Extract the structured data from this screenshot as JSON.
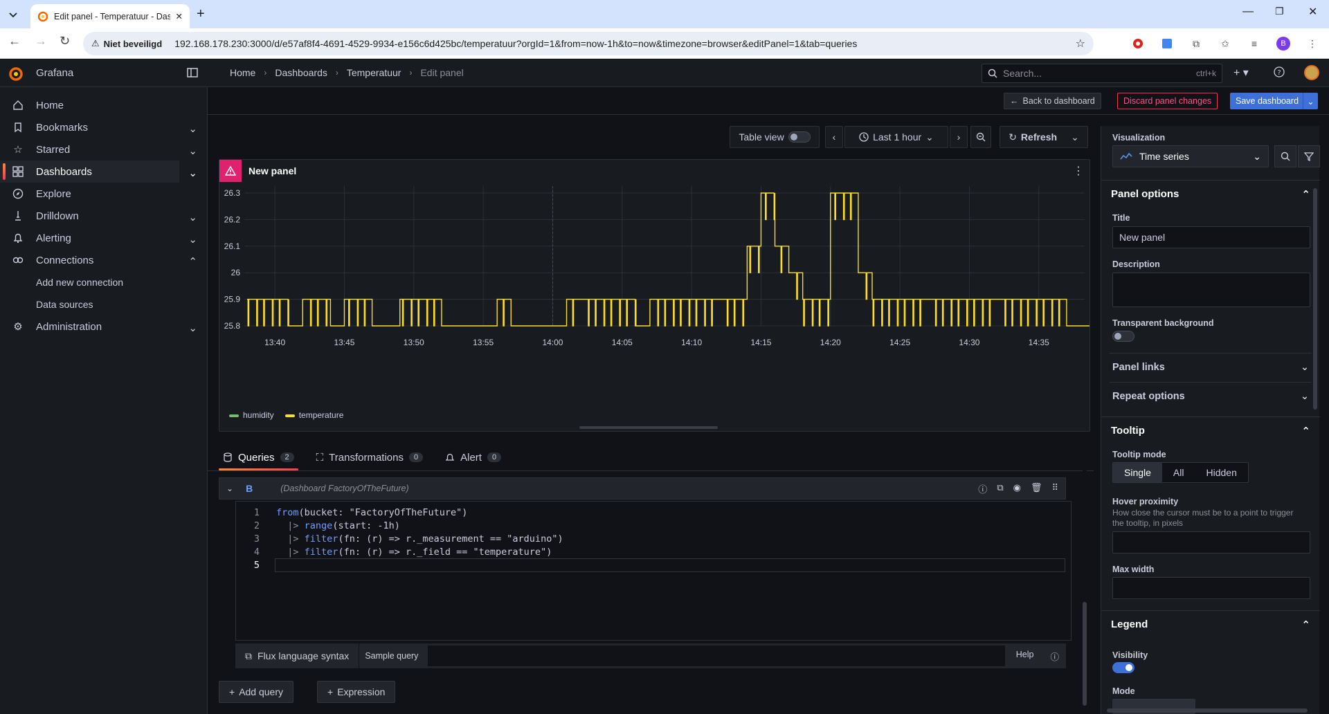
{
  "browser": {
    "tab_title": "Edit panel - Temperatuur - Dashb",
    "security_label": "Niet beveiligd",
    "url": "192.168.178.230:3000/d/e57af8f4-4691-4529-9934-e156c6d425bc/temperatuur?orgId=1&from=now-1h&to=now&timezone=browser&editPanel=1&tab=queries",
    "profile_initial": "B"
  },
  "header": {
    "brand": "Grafana",
    "breadcrumbs": [
      "Home",
      "Dashboards",
      "Temperatuur",
      "Edit panel"
    ],
    "search_placeholder": "Search...",
    "search_shortcut": "ctrl+k"
  },
  "sidebar": {
    "items": [
      {
        "label": "Home",
        "icon": "home-icon"
      },
      {
        "label": "Bookmarks",
        "icon": "bookmark-icon"
      },
      {
        "label": "Starred",
        "icon": "star-icon"
      },
      {
        "label": "Dashboards",
        "icon": "apps-icon"
      },
      {
        "label": "Explore",
        "icon": "compass-icon"
      },
      {
        "label": "Drilldown",
        "icon": "drilldown-icon"
      },
      {
        "label": "Alerting",
        "icon": "bell-icon"
      },
      {
        "label": "Connections",
        "icon": "connections-icon"
      },
      {
        "label": "Add new connection"
      },
      {
        "label": "Data sources"
      },
      {
        "label": "Administration",
        "icon": "cog-icon"
      }
    ]
  },
  "toolbar": {
    "back": "Back to dashboard",
    "discard": "Discard panel changes",
    "save": "Save dashboard"
  },
  "timebar": {
    "table_view": "Table view",
    "range": "Last 1 hour",
    "refresh": "Refresh"
  },
  "panel": {
    "title": "New panel",
    "legend": [
      {
        "name": "humidity",
        "color": "#73bf69"
      },
      {
        "name": "temperature",
        "color": "#fade2a"
      }
    ]
  },
  "chart_data": {
    "type": "line",
    "title": "New panel",
    "x_ticks": [
      "13:40",
      "13:45",
      "13:50",
      "13:55",
      "14:00",
      "14:05",
      "14:10",
      "14:15",
      "14:20",
      "14:25",
      "14:30",
      "14:35"
    ],
    "y_ticks": [
      "26.3",
      "26.2",
      "26.1",
      "26",
      "25.9",
      "25.8"
    ],
    "ylim": [
      25.8,
      26.3
    ],
    "grid": true,
    "legend_placement": "bottom-left",
    "series": [
      {
        "name": "temperature",
        "color": "#fade2a",
        "x": [
          "13:38",
          "13:39",
          "13:40",
          "13:41",
          "13:42",
          "13:43",
          "13:44",
          "13:45",
          "13:46",
          "13:47",
          "13:48",
          "13:49",
          "13:50",
          "13:51",
          "13:52",
          "13:53",
          "13:54",
          "13:55",
          "13:56",
          "13:57",
          "13:58",
          "13:59",
          "14:00",
          "14:01",
          "14:02",
          "14:03",
          "14:04",
          "14:05",
          "14:06",
          "14:07",
          "14:08",
          "14:09",
          "14:10",
          "14:11",
          "14:12",
          "14:13",
          "14:14",
          "14:15",
          "14:16",
          "14:17",
          "14:18",
          "14:19",
          "14:20",
          "14:21",
          "14:22",
          "14:23",
          "14:24",
          "14:25",
          "14:26",
          "14:27",
          "14:28",
          "14:29",
          "14:30",
          "14:31",
          "14:32",
          "14:33",
          "14:34",
          "14:35",
          "14:36",
          "14:37",
          "14:38"
        ],
        "y": [
          25.9,
          25.9,
          25.9,
          25.8,
          25.9,
          25.9,
          25.8,
          25.9,
          25.9,
          25.8,
          25.8,
          25.9,
          25.9,
          25.9,
          25.8,
          25.8,
          25.8,
          25.8,
          25.9,
          25.8,
          25.8,
          25.8,
          25.8,
          25.9,
          25.9,
          25.9,
          25.9,
          25.9,
          25.8,
          25.9,
          25.9,
          25.9,
          25.9,
          25.9,
          25.9,
          25.9,
          26.1,
          26.3,
          26.1,
          26.0,
          25.9,
          25.9,
          26.3,
          26.3,
          26.0,
          25.9,
          25.9,
          25.9,
          25.9,
          25.9,
          25.9,
          25.9,
          25.9,
          25.9,
          25.9,
          25.9,
          25.9,
          25.9,
          25.9,
          25.8,
          25.8
        ]
      }
    ]
  },
  "tabs": [
    {
      "label": "Queries",
      "count": "2"
    },
    {
      "label": "Transformations",
      "count": "0"
    },
    {
      "label": "Alert",
      "count": "0"
    }
  ],
  "query": {
    "ref": "B",
    "datasource": "(Dashboard FactoryOfTheFuture)",
    "lines": [
      "1",
      "2",
      "3",
      "4",
      "5"
    ],
    "flux_syntax": "Flux language syntax",
    "sample_query": "Sample query",
    "help": "Help",
    "add_query": "Add query",
    "expression": "Expression"
  },
  "options": {
    "viz_label": "Visualization",
    "viz_value": "Time series",
    "panel_options": "Panel options",
    "title_label": "Title",
    "title_value": "New panel",
    "description_label": "Description",
    "transparent_label": "Transparent background",
    "panel_links": "Panel links",
    "repeat_options": "Repeat options",
    "tooltip": "Tooltip",
    "tooltip_mode": "Tooltip mode",
    "modes": [
      "Single",
      "All",
      "Hidden"
    ],
    "hover_label": "Hover proximity",
    "hover_desc": "How close the cursor must be to a point to trigger the tooltip, in pixels",
    "max_width": "Max width",
    "legend": "Legend",
    "visibility": "Visibility",
    "mode": "Mode"
  }
}
